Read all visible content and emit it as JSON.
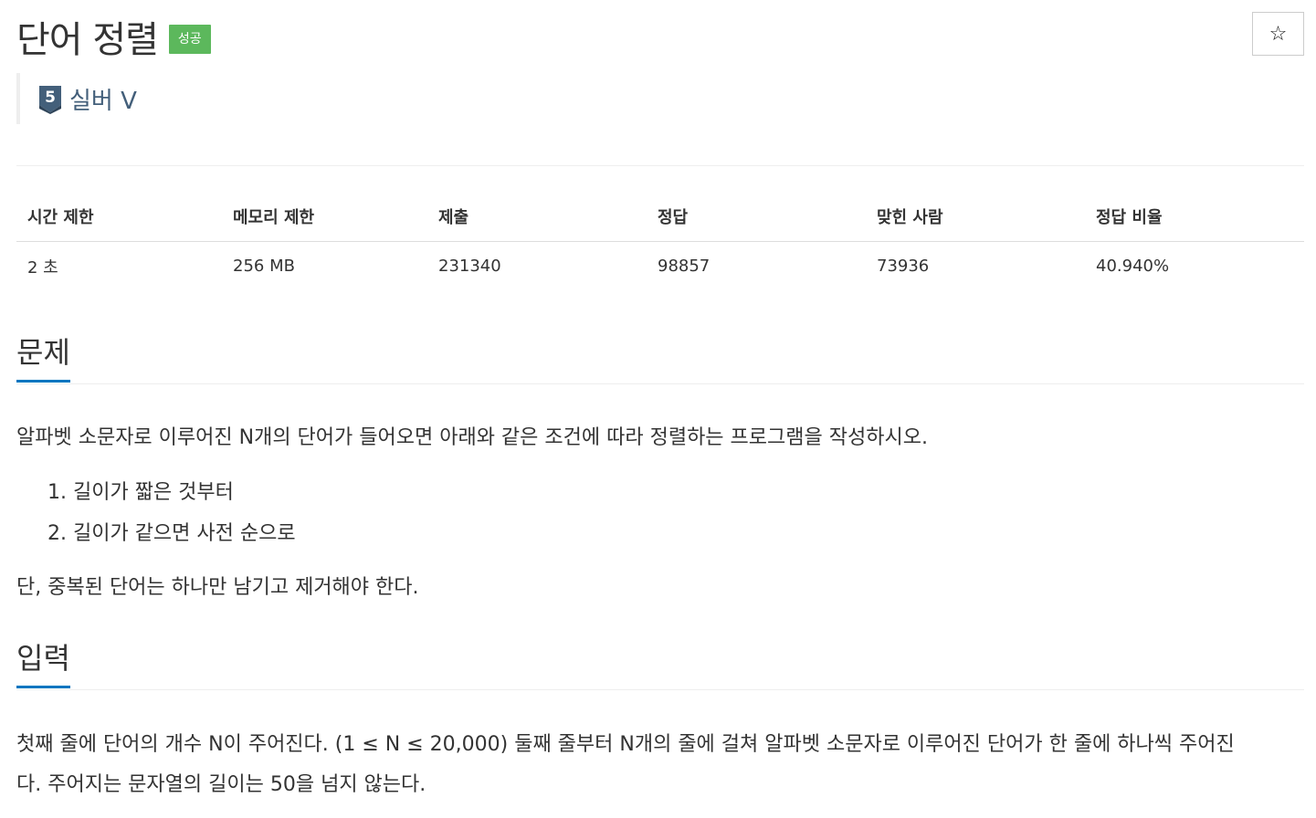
{
  "header": {
    "title": "단어 정렬",
    "status_badge": "성공",
    "star_icon_glyph": "☆",
    "tier": {
      "level": "5",
      "label": "실버 V",
      "color": "#435f7a"
    }
  },
  "info_table": {
    "headers": [
      "시간 제한",
      "메모리 제한",
      "제출",
      "정답",
      "맞힌 사람",
      "정답 비율"
    ],
    "values": [
      "2 초",
      "256 MB",
      "231340",
      "98857",
      "73936",
      "40.940%"
    ]
  },
  "problem": {
    "heading": "문제",
    "intro": "알파벳 소문자로 이루어진 N개의 단어가 들어오면 아래와 같은 조건에 따라 정렬하는 프로그램을 작성하시오.",
    "conditions": [
      "1. 길이가 짧은 것부터",
      "2. 길이가 같으면 사전 순으로"
    ],
    "note": "단, 중복된 단어는 하나만 남기고 제거해야 한다."
  },
  "input": {
    "heading": "입력",
    "text_line1": "첫째 줄에 단어의 개수 N이 주어진다. (1 ≤ N ≤ 20,000) 둘째 줄부터 N개의 줄에 걸쳐 알파벳 소문자로 이루어진 단어가 한 줄에 하나씩 주어진",
    "text_line2": "다. 주어지는 문자열의 길이는 50을 넘지 않는다."
  },
  "colors": {
    "badge_success": "#5cb85c",
    "section_underline": "#0076c0"
  }
}
